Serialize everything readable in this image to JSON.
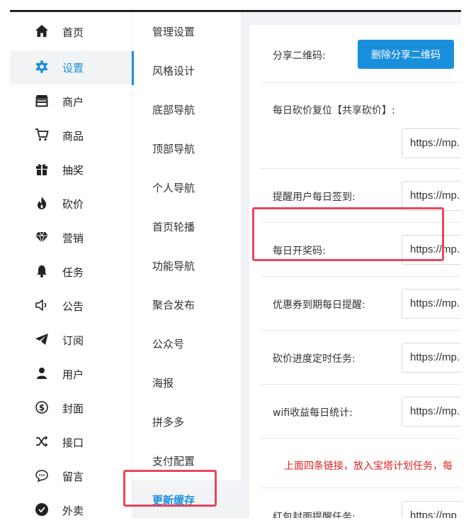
{
  "sidebar": {
    "items": [
      {
        "label": "首页",
        "icon": "home-icon"
      },
      {
        "label": "设置",
        "icon": "gear-icon",
        "active": true
      },
      {
        "label": "商户",
        "icon": "store-icon"
      },
      {
        "label": "商品",
        "icon": "cart-icon"
      },
      {
        "label": "抽奖",
        "icon": "gift-icon"
      },
      {
        "label": "砍价",
        "icon": "flame-icon"
      },
      {
        "label": "营销",
        "icon": "diamond-icon"
      },
      {
        "label": "任务",
        "icon": "bell-icon"
      },
      {
        "label": "公告",
        "icon": "speaker-icon"
      },
      {
        "label": "订阅",
        "icon": "send-icon"
      },
      {
        "label": "用户",
        "icon": "user-icon"
      },
      {
        "label": "封面",
        "icon": "dollar-circle-icon"
      },
      {
        "label": "接口",
        "icon": "shuffle-icon"
      },
      {
        "label": "留言",
        "icon": "chat-bubble-icon"
      },
      {
        "label": "外卖",
        "icon": "reward-badge-icon"
      }
    ]
  },
  "subnav": {
    "items": [
      {
        "label": "管理设置"
      },
      {
        "label": "风格设计"
      },
      {
        "label": "底部导航"
      },
      {
        "label": "顶部导航"
      },
      {
        "label": "个人导航"
      },
      {
        "label": "首页轮播"
      },
      {
        "label": "功能导航"
      },
      {
        "label": "聚合发布"
      },
      {
        "label": "公众号"
      },
      {
        "label": "海报"
      },
      {
        "label": "拼多多"
      },
      {
        "label": "支付配置"
      },
      {
        "label": "更新缓存",
        "current": true
      }
    ]
  },
  "content": {
    "share_qr_label": "分享二维码:",
    "delete_share_qr_button": "删除分享二维码",
    "rows": {
      "bargain_reset": {
        "label": "每日砍价复位【共享砍价】:",
        "value": "https://mp."
      },
      "signin_reminder": {
        "label": "提醒用户每日签到:",
        "value": "https://mp."
      },
      "lottery_daily": {
        "label": "每日开奖码:",
        "value": "https://mp."
      },
      "coupon_expiry": {
        "label": "优惠券到期每日提醒:",
        "value": "https://mp."
      },
      "bargain_progress": {
        "label": "砍价进度定时任务:",
        "value": "https://mp."
      },
      "wifi_stats": {
        "label": "wifi收益每日统计:",
        "value": "https://mp."
      },
      "red_packet_cover": {
        "label": "红包封面提醒任务:",
        "value": "https://mp"
      }
    },
    "note": "上面四条链接，放入宝塔计划任务，每"
  },
  "colors": {
    "accent": "#1a8fdc",
    "highlight": "#e8475c",
    "note": "#e02020"
  }
}
